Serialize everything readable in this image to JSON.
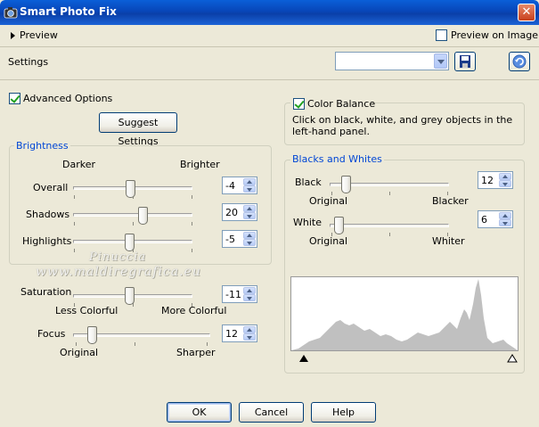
{
  "window": {
    "title": "Smart Photo Fix",
    "close": "✕"
  },
  "preview": {
    "label": "Preview",
    "preview_on_image": "Preview on Image",
    "preview_on_image_checked": false
  },
  "settings": {
    "label": "Settings",
    "preset_value": ""
  },
  "advanced": {
    "label": "Advanced Options",
    "checked": true,
    "suggest_button": "Suggest Settings"
  },
  "brightness": {
    "group_label": "Brightness",
    "darker": "Darker",
    "brighter": "Brighter",
    "overall": {
      "label": "Overall",
      "value": "-4"
    },
    "shadows": {
      "label": "Shadows",
      "value": "20"
    },
    "highlights": {
      "label": "Highlights",
      "value": "-5"
    }
  },
  "saturation": {
    "label": "Saturation",
    "value": "-11",
    "left": "Less Colorful",
    "right": "More Colorful"
  },
  "focus": {
    "label": "Focus",
    "value": "12",
    "left": "Original",
    "right": "Sharper"
  },
  "color_balance": {
    "label": "Color Balance",
    "checked": true,
    "description": "Click on black, white, and grey objects in the left-hand panel."
  },
  "blacks_whites": {
    "group_label": "Blacks and Whites",
    "black": {
      "label": "Black",
      "value": "12",
      "left": "Original",
      "right": "Blacker"
    },
    "white": {
      "label": "White",
      "value": "6",
      "left": "Original",
      "right": "Whiter"
    }
  },
  "watermark": {
    "line1": "Pinuccia",
    "line2": "www.maldiregrafica.eu"
  },
  "buttons": {
    "ok": "OK",
    "cancel": "Cancel",
    "help": "Help"
  },
  "colors": {
    "titlebar": "#0a50c8",
    "dialog": "#ece9d8",
    "group_label": "#0046d5",
    "histogram": "#c0c0c0"
  }
}
